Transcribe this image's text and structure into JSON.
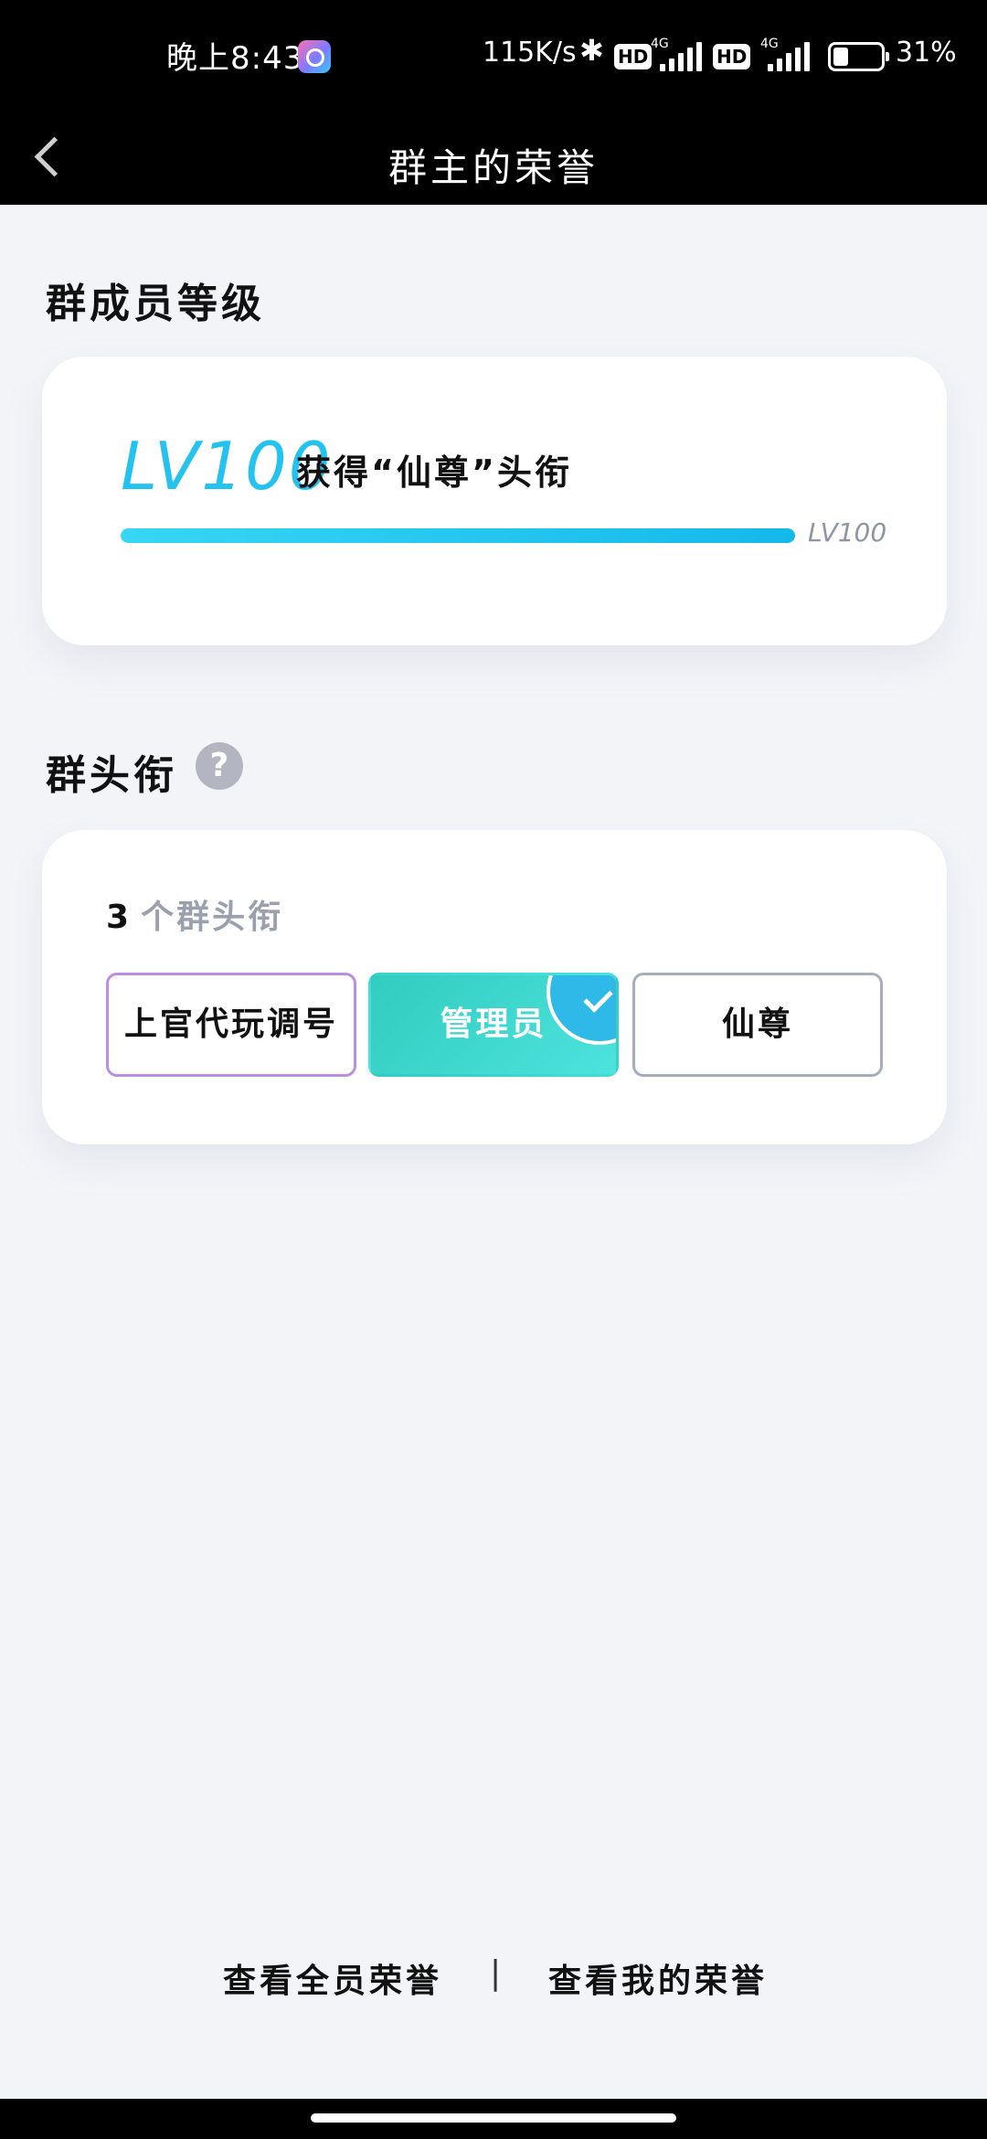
{
  "status_bar": {
    "time": "晚上8:43",
    "net_speed": "115K/s",
    "bluetooth_glyph": "✱",
    "hd1": "HD",
    "hd2": "HD",
    "signal1_label": "4G",
    "signal2_label": "4G",
    "battery_pct": "31%",
    "battery_level": 0.31
  },
  "header": {
    "title": "群主的荣誉"
  },
  "level_section": {
    "title": "群成员等级",
    "level_value": "LV100",
    "level_desc": "获得“仙尊”头衔",
    "progress": 1.0,
    "progress_end_label": "LV100"
  },
  "titles_section": {
    "title": "群头衔",
    "help_glyph": "?",
    "count_num": "3",
    "count_label": "个群头衔",
    "tags": [
      {
        "label": "上官代玩调号",
        "state": "outlined-purple"
      },
      {
        "label": "管理员",
        "state": "selected"
      },
      {
        "label": "仙尊",
        "state": "outlined-gray"
      }
    ]
  },
  "footer": {
    "view_all": "查看全员荣誉",
    "separator": "|",
    "view_mine": "查看我的荣誉"
  },
  "colors": {
    "accent": "#24c3ef",
    "selected_tag": "#33ccc0",
    "check_badge": "#2fb9e8",
    "purple_border": "#b98ee4"
  }
}
